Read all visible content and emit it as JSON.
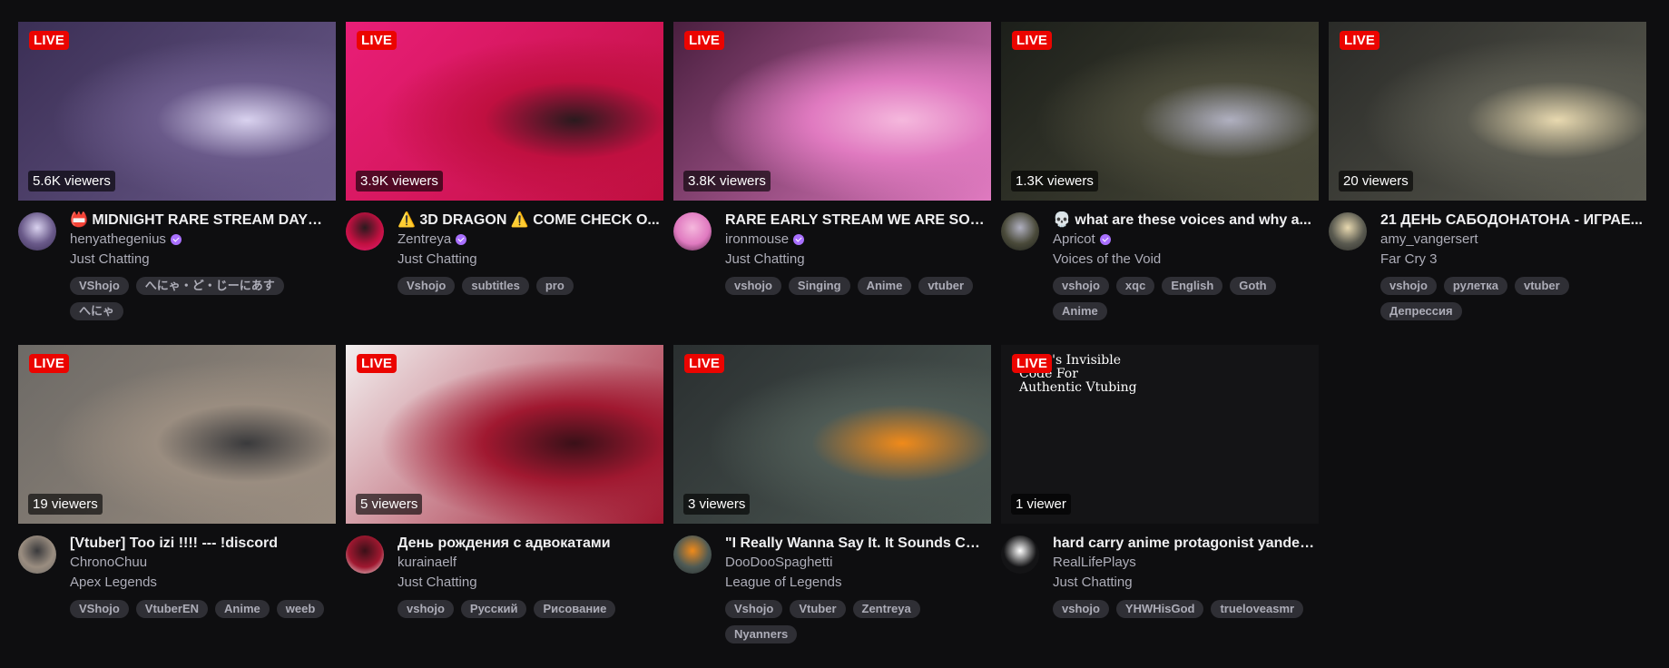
{
  "live_label": "LIVE",
  "cards": [
    {
      "viewers": "5.6K viewers",
      "title": "📛 MIDNIGHT RARE STREAM DAYO~ ...",
      "channel": "henyathegenius",
      "verified": true,
      "category": "Just Chatting",
      "tags": [
        "VShojo",
        "へにゃ・ど・じーにあす",
        "へにゃ"
      ],
      "colors": [
        "#3b2f55",
        "#6a5a8a",
        "#d9d2ef"
      ]
    },
    {
      "viewers": "3.9K viewers",
      "title": "⚠️ 3D DRAGON ⚠️ COME CHECK O...",
      "channel": "Zentreya",
      "verified": true,
      "category": "Just Chatting",
      "tags": [
        "Vshojo",
        "subtitles",
        "pro"
      ],
      "colors": [
        "#e91e78",
        "#c01040",
        "#2a1a1e"
      ]
    },
    {
      "viewers": "3.8K viewers",
      "title": "RARE EARLY STREAM WE ARE SO B...",
      "channel": "ironmouse",
      "verified": true,
      "category": "Just Chatting",
      "tags": [
        "vshojo",
        "Singing",
        "Anime",
        "vtuber"
      ],
      "colors": [
        "#4a1f3f",
        "#e07ac0",
        "#f5b8dd"
      ]
    },
    {
      "viewers": "1.3K viewers",
      "title": "💀 what are these voices and why a...",
      "channel": "Apricot",
      "verified": true,
      "category": "Voices of the Void",
      "tags": [
        "vshojo",
        "xqc",
        "English",
        "Goth",
        "Anime"
      ],
      "colors": [
        "#1c1f1a",
        "#4a4a3a",
        "#b0b0c0"
      ]
    },
    {
      "viewers": "20 viewers",
      "title": "21 ДЕНЬ САБОДОНАТОНА - ИГРАЕ...",
      "channel": "amy_vangersert",
      "verified": false,
      "category": "Far Cry 3",
      "tags": [
        "vshojo",
        "рулетка",
        "vtuber",
        "Депрессия"
      ],
      "colors": [
        "#2a2b28",
        "#5a5a50",
        "#e8d9b0"
      ]
    },
    {
      "viewers": "19 viewers",
      "title": "[Vtuber] Too izi !!!! --- !discord",
      "channel": "ChronoChuu",
      "verified": false,
      "category": "Apex Legends",
      "tags": [
        "VShojo",
        "VtuberEN",
        "Anime",
        "weeb"
      ],
      "colors": [
        "#6d6a66",
        "#9a8d80",
        "#3a3a3c"
      ]
    },
    {
      "viewers": "5 viewers",
      "title": "День рождения с адвокатами",
      "channel": "kurainaelf",
      "verified": false,
      "category": "Just Chatting",
      "tags": [
        "vshojo",
        "Русский",
        "Рисование"
      ],
      "colors": [
        "#f2eeee",
        "#a01830",
        "#3a1018"
      ]
    },
    {
      "viewers": "3 viewers",
      "title": "\"I Really Wanna Say It. It Sounds Cut...",
      "channel": "DooDooSpaghetti",
      "verified": false,
      "category": "League of Legends",
      "tags": [
        "Vshojo",
        "Vtuber",
        "Zentreya",
        "Nyanners"
      ],
      "colors": [
        "#2a2f30",
        "#4e5a55",
        "#f08a1a"
      ]
    },
    {
      "viewers": "1 viewer",
      "title": "hard carry anime protagonist yander...",
      "channel": "RealLifePlays",
      "verified": false,
      "category": "Just Chatting",
      "tags": [
        "vshojo",
        "YHWHisGod",
        "trueloveasmr"
      ],
      "colors": [
        "#141416",
        "#141416",
        "#ffffff"
      ],
      "thumb_text": "l Life's Invisible Code For Authentic Vtubing"
    }
  ]
}
